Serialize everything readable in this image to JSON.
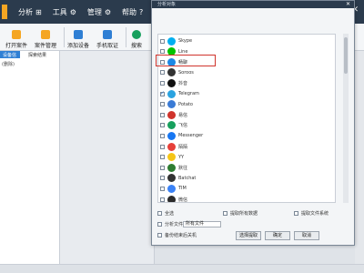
{
  "menubar": {
    "items": [
      {
        "label": "分析",
        "icon": "analysis-icon"
      },
      {
        "label": "工具",
        "icon": "tools-icon"
      },
      {
        "label": "管理",
        "icon": "manage-icon"
      },
      {
        "label": "帮助",
        "icon": "help-icon"
      }
    ],
    "window_controls": [
      "▾",
      "—",
      "✕"
    ]
  },
  "toolbar": {
    "buttons": [
      "打开案件",
      "案件管理",
      "添加设备",
      "手机取证",
      "搜索"
    ]
  },
  "left_panel": {
    "tabs": [
      "设备信息",
      "探索结果"
    ],
    "sub_label": "(删除)"
  },
  "dialog": {
    "title": "分析对象",
    "close": "✕",
    "apps": [
      {
        "name": "Skype",
        "checked": false,
        "color": "#00aff0"
      },
      {
        "name": "Line",
        "checked": false,
        "color": "#00c300"
      },
      {
        "name": "畅聊",
        "checked": false,
        "color": "#1e88e5"
      },
      {
        "name": "Soroos",
        "checked": false,
        "color": "#333333"
      },
      {
        "name": "抖音",
        "checked": false,
        "color": "#111111"
      },
      {
        "name": "Telegram",
        "checked": true,
        "color": "#2aa3e0"
      },
      {
        "name": "Potato",
        "checked": false,
        "color": "#3a7bd5"
      },
      {
        "name": "易信",
        "checked": false,
        "color": "#d0342c"
      },
      {
        "name": "飞信",
        "checked": false,
        "color": "#17a05d"
      },
      {
        "name": "Messenger",
        "checked": false,
        "color": "#1877f2"
      },
      {
        "name": "陌陌",
        "checked": false,
        "color": "#e6403a"
      },
      {
        "name": "YY",
        "checked": false,
        "color": "#f5c518"
      },
      {
        "name": "默往",
        "checked": false,
        "color": "#2e7d32"
      },
      {
        "name": "Batchat",
        "checked": false,
        "color": "#333333"
      },
      {
        "name": "TIM",
        "checked": false,
        "color": "#3b82f6"
      },
      {
        "name": "微信",
        "checked": false,
        "color": "#2b2b2b"
      }
    ],
    "options": {
      "opt1": "全选",
      "opt2": "提取所有数据",
      "opt3": "提取文件系统",
      "opt4": "分析文件类型",
      "opt5": "备份结束后关机",
      "select_value": "所有文件"
    },
    "buttons": [
      "选择提取",
      "确定",
      "取消"
    ]
  },
  "colors": {
    "menubar_bg": "#2b3b4d",
    "accent": "#2f7fd4",
    "highlight_border": "#d0342c"
  }
}
